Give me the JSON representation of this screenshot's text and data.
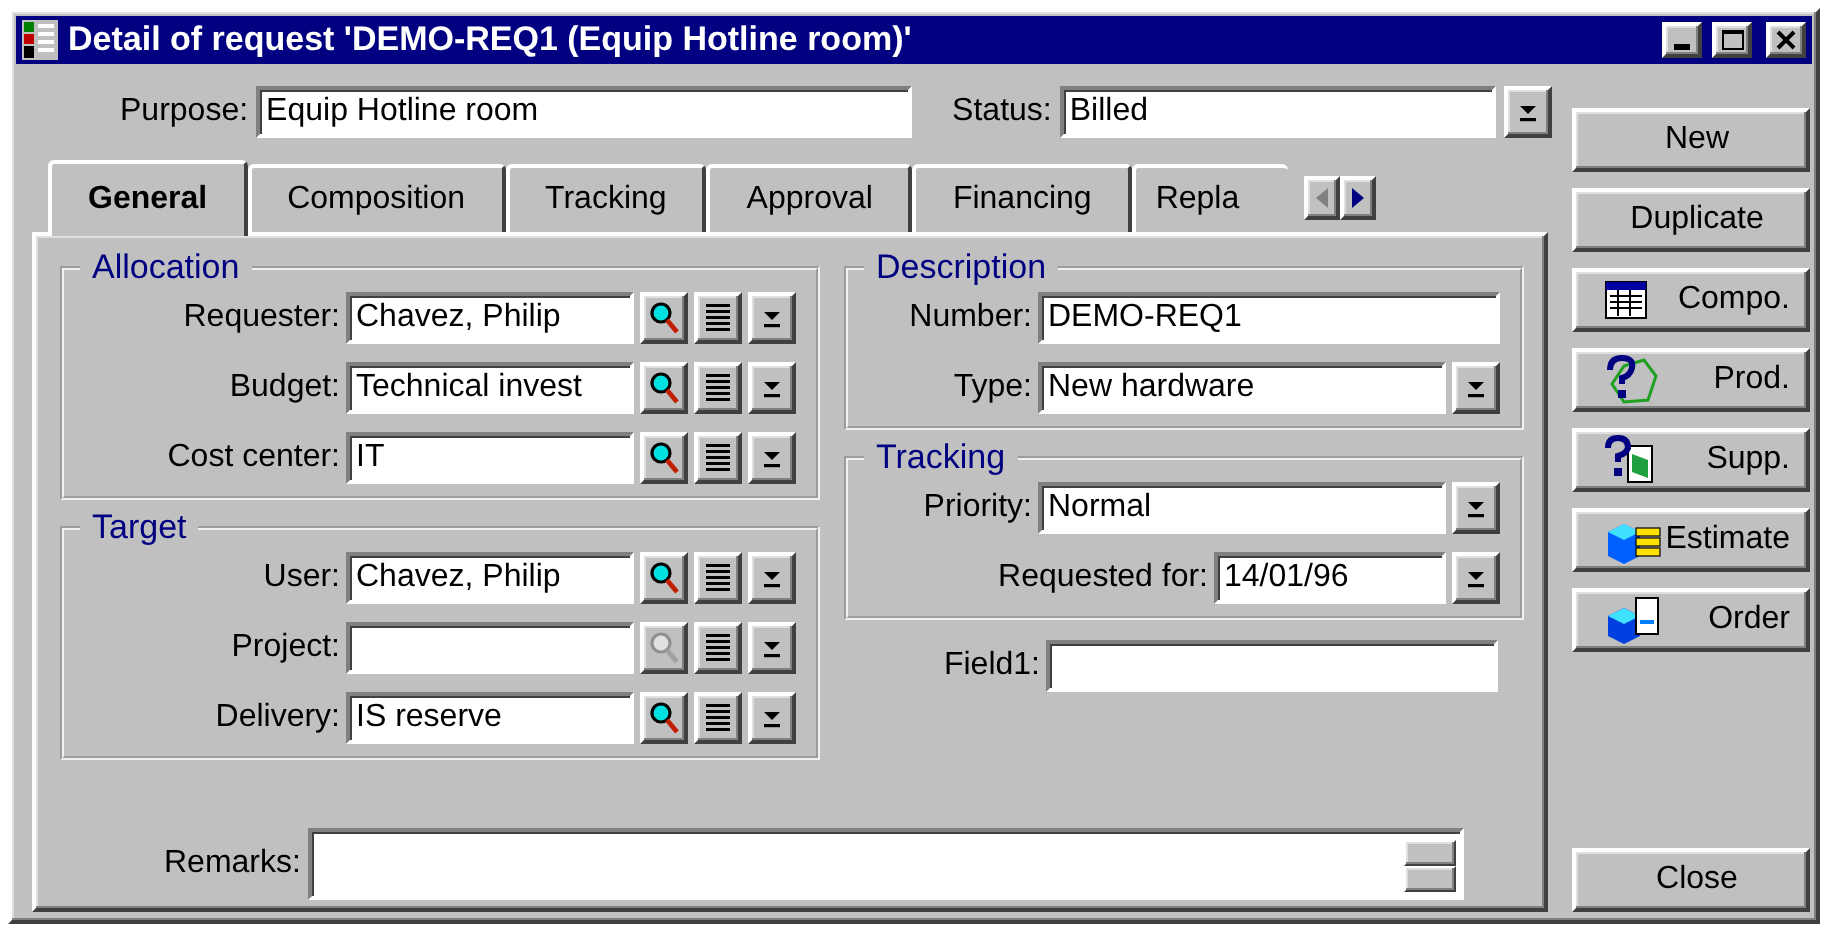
{
  "window": {
    "title": "Detail of request 'DEMO-REQ1 (Equip Hotline room)'"
  },
  "purpose": {
    "label": "Purpose:",
    "value": "Equip Hotline room"
  },
  "status": {
    "label": "Status:",
    "value": "Billed"
  },
  "tabs": [
    {
      "label": "General",
      "selected": true
    },
    {
      "label": "Composition",
      "selected": false
    },
    {
      "label": "Tracking",
      "selected": false
    },
    {
      "label": "Approval",
      "selected": false
    },
    {
      "label": "Financing",
      "selected": false
    },
    {
      "label": "Repla",
      "selected": false
    }
  ],
  "tab_scroll": {
    "left_enabled": false,
    "right_enabled": true
  },
  "allocation": {
    "title": "Allocation",
    "fields": [
      {
        "label": "Requester:",
        "value": "Chavez, Philip",
        "lookup_enabled": true
      },
      {
        "label": "Budget:",
        "value": "Technical invest",
        "lookup_enabled": true
      },
      {
        "label": "Cost center:",
        "value": "IT",
        "lookup_enabled": true
      }
    ]
  },
  "target": {
    "title": "Target",
    "fields": [
      {
        "label": "User:",
        "value": "Chavez, Philip",
        "lookup_enabled": true
      },
      {
        "label": "Project:",
        "lookup_enabled": false
      },
      {
        "label": "Delivery:",
        "value": "IS reserve",
        "lookup_enabled": true
      }
    ]
  },
  "description": {
    "title": "Description",
    "fields": [
      {
        "kind": "text",
        "label": "Number:",
        "value": "DEMO-REQ1"
      },
      {
        "kind": "combo",
        "label": "Type:",
        "value": "New hardware"
      }
    ]
  },
  "tracking": {
    "title": "Tracking",
    "fields": [
      {
        "kind": "combo",
        "label": "Priority:",
        "value": "Normal"
      },
      {
        "kind": "combo",
        "label": "Requested for:",
        "value": "14/01/96"
      }
    ]
  },
  "field1": {
    "label": "Field1:"
  },
  "remarks": {
    "label": "Remarks:"
  },
  "buttons": [
    {
      "label": "New"
    },
    {
      "label": "Duplicate"
    },
    {
      "label": "Compo."
    },
    {
      "label": "Prod."
    },
    {
      "label": "Supp."
    },
    {
      "label": "Estimate"
    },
    {
      "label": "Order"
    },
    {
      "label": "Close"
    }
  ]
}
